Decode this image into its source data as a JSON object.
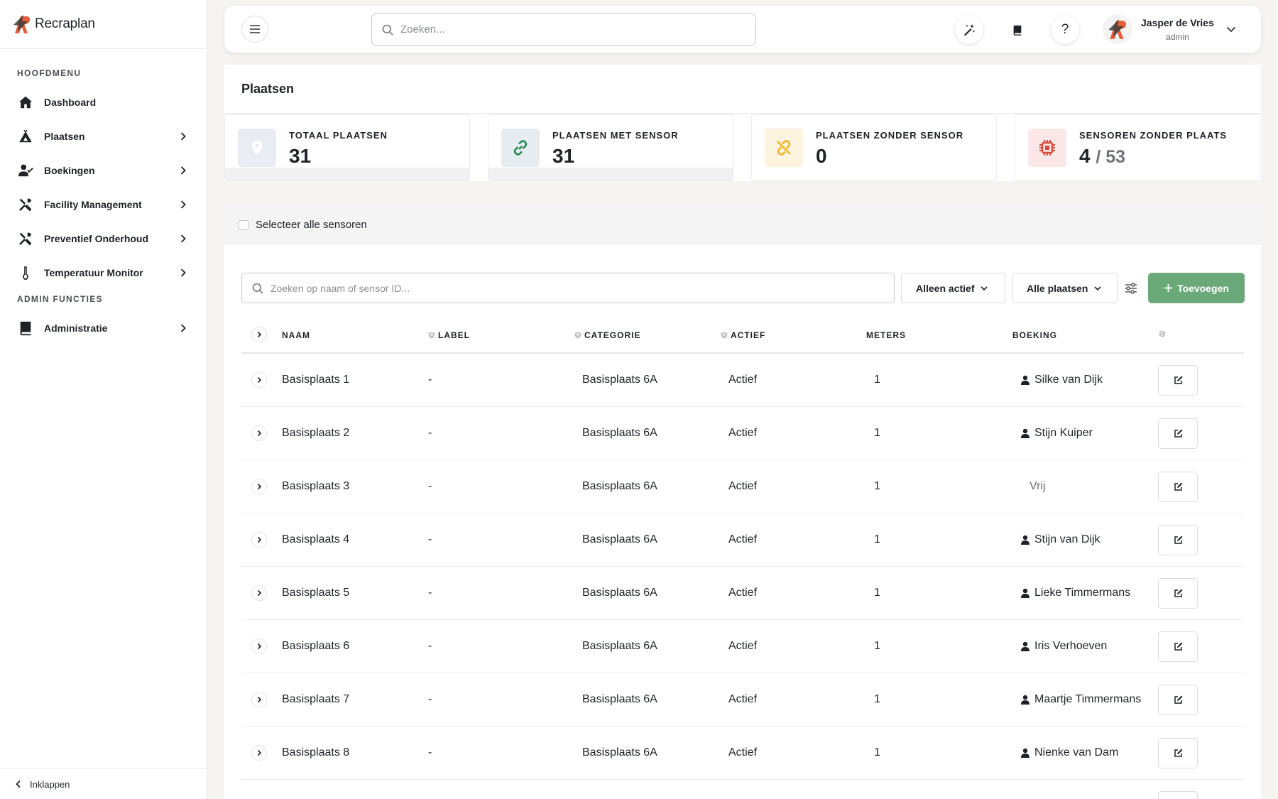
{
  "app": {
    "name": "Recraplan"
  },
  "sidebar": {
    "main_section": "HOOFDMENU",
    "admin_section": "ADMIN FUNCTIES",
    "items": [
      {
        "label": "Dashboard",
        "icon": "home-icon"
      },
      {
        "label": "Plaatsen",
        "icon": "campsite-icon"
      },
      {
        "label": "Boekingen",
        "icon": "user-check-icon"
      },
      {
        "label": "Facility Management",
        "icon": "tools-icon"
      },
      {
        "label": "Preventief Onderhoud",
        "icon": "tools-icon"
      },
      {
        "label": "Temperatuur Monitor",
        "icon": "thermometer-icon"
      }
    ],
    "admin_items": [
      {
        "label": "Administratie",
        "icon": "book-icon"
      }
    ],
    "collapse_label": "Inklappen"
  },
  "topbar": {
    "search_placeholder": "Zoeken...",
    "user": {
      "name": "Jasper de Vries",
      "role": "admin"
    }
  },
  "page": {
    "title": "Plaatsen",
    "stats": [
      {
        "label": "TOTAAL PLAATSEN",
        "value": "31",
        "icon": "map-pin-icon",
        "color": "#e9edf3"
      },
      {
        "label": "PLAATSEN MET SENSOR",
        "value": "31",
        "icon": "link-icon",
        "color": "#e6ecef"
      },
      {
        "label": "PLAATSEN ZONDER SENSOR",
        "value": "0",
        "icon": "unlink-icon",
        "color": "#fdf4df"
      },
      {
        "label": "SENSOREN ZONDER PLAATS",
        "value": "4",
        "value_sub": "/ 53",
        "icon": "chip-icon",
        "color": "#fbe7e7"
      }
    ],
    "select_all_label": "Selecteer alle sensoren",
    "filters": {
      "search_placeholder": "Zoeken op naam of sensor ID...",
      "active_filter": "Alleen actief",
      "place_filter": "Alle plaatsen",
      "add_label": "Toevoegen"
    },
    "columns": {
      "naam": "NAAM",
      "label": "LABEL",
      "categorie": "CATEGORIE",
      "actief": "ACTIEF",
      "meters": "METERS",
      "boeking": "BOEKING"
    },
    "rows": [
      {
        "naam": "Basisplaats 1",
        "label": "-",
        "categorie": "Basisplaats 6A",
        "actief": "Actief",
        "meters": "1",
        "boeking": "Silke van Dijk"
      },
      {
        "naam": "Basisplaats 2",
        "label": "-",
        "categorie": "Basisplaats 6A",
        "actief": "Actief",
        "meters": "1",
        "boeking": "Stijn Kuiper"
      },
      {
        "naam": "Basisplaats 3",
        "label": "-",
        "categorie": "Basisplaats 6A",
        "actief": "Actief",
        "meters": "1",
        "boeking": "Vrij"
      },
      {
        "naam": "Basisplaats 4",
        "label": "-",
        "categorie": "Basisplaats 6A",
        "actief": "Actief",
        "meters": "1",
        "boeking": "Stijn van Dijk"
      },
      {
        "naam": "Basisplaats 5",
        "label": "-",
        "categorie": "Basisplaats 6A",
        "actief": "Actief",
        "meters": "1",
        "boeking": "Lieke Timmermans"
      },
      {
        "naam": "Basisplaats 6",
        "label": "-",
        "categorie": "Basisplaats 6A",
        "actief": "Actief",
        "meters": "1",
        "boeking": "Iris Verhoeven"
      },
      {
        "naam": "Basisplaats 7",
        "label": "-",
        "categorie": "Basisplaats 6A",
        "actief": "Actief",
        "meters": "1",
        "boeking": "Maartje Timmermans"
      },
      {
        "naam": "Basisplaats 8",
        "label": "-",
        "categorie": "Basisplaats 6A",
        "actief": "Actief",
        "meters": "1",
        "boeking": "Nienke van Dam"
      }
    ]
  },
  "colors": {
    "accent": "#6aa97a",
    "brand_orange": "#e85d3a",
    "brand_dark": "#3c3c3c"
  }
}
